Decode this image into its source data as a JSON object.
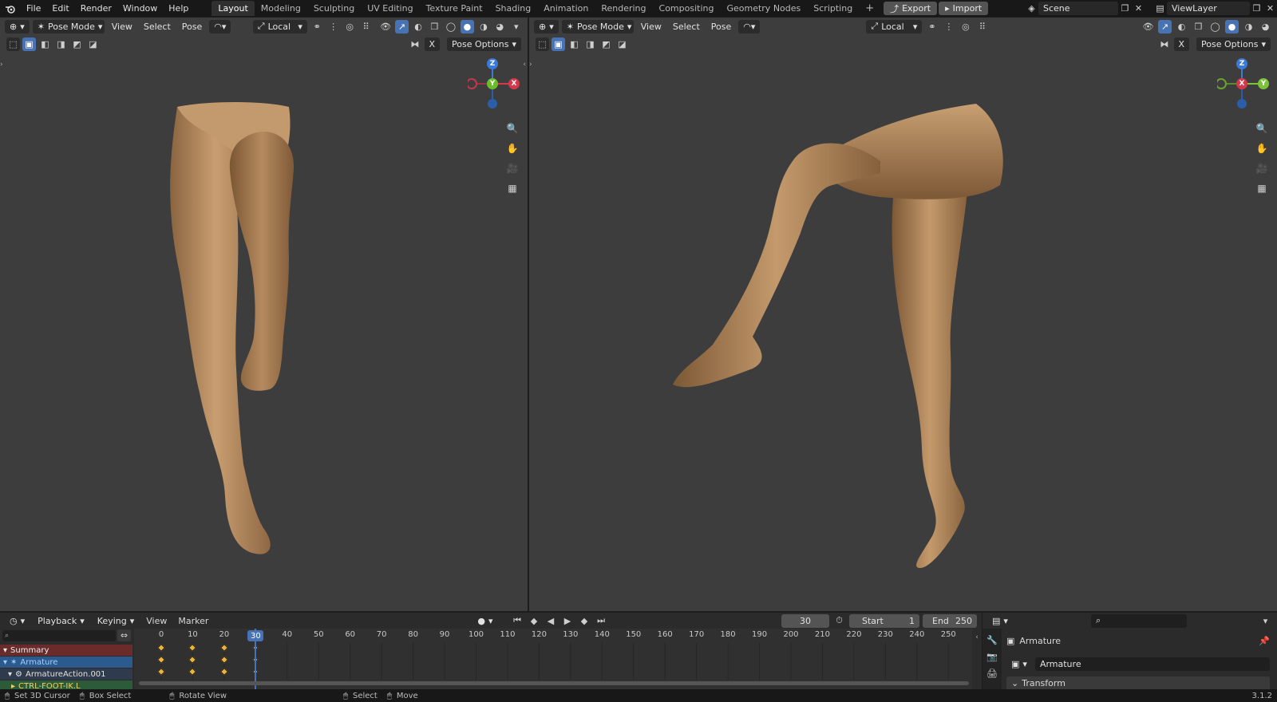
{
  "topbar": {
    "menus": [
      "File",
      "Edit",
      "Render",
      "Window",
      "Help"
    ],
    "workspaces": [
      "Layout",
      "Modeling",
      "Sculpting",
      "UV Editing",
      "Texture Paint",
      "Shading",
      "Animation",
      "Rendering",
      "Compositing",
      "Geometry Nodes",
      "Scripting"
    ],
    "active_workspace": "Layout",
    "add_tab": "+",
    "export_label": "Export",
    "import_label": "Import",
    "scene": "Scene",
    "view_layer": "ViewLayer"
  },
  "viewport_left": {
    "mode": "Pose Mode",
    "menus": [
      "View",
      "Select",
      "Pose"
    ],
    "orientation": "Local",
    "pose_options": "Pose Options",
    "x_label": "X",
    "gizmo": {
      "z": "Z",
      "y": "Y",
      "x": "X"
    }
  },
  "viewport_right": {
    "mode": "Pose Mode",
    "menus": [
      "View",
      "Select",
      "Pose"
    ],
    "orientation": "Local",
    "pose_options": "Pose Options",
    "x_label": "X",
    "gizmo": {
      "z": "Z",
      "y": "Y",
      "x": "X"
    }
  },
  "timeline": {
    "menus": [
      "Playback",
      "Keying",
      "View",
      "Marker"
    ],
    "current_frame": "30",
    "start_label": "Start",
    "start_value": "1",
    "end_label": "End",
    "end_value": "250",
    "ticks": [
      "0",
      "10",
      "20",
      "30",
      "40",
      "50",
      "60",
      "70",
      "80",
      "90",
      "100",
      "110",
      "120",
      "130",
      "140",
      "150",
      "160",
      "170",
      "180",
      "190",
      "200",
      "210",
      "220",
      "230",
      "240",
      "250"
    ],
    "channels": [
      "Summary",
      "Armature",
      "ArmatureAction.001",
      "CTRL-FOOT-IK.L"
    ],
    "keyframes": [
      0,
      10,
      20
    ]
  },
  "properties": {
    "object_name": "Armature",
    "data_name": "Armature",
    "section": "Transform"
  },
  "status": {
    "items": [
      "Set 3D Cursor",
      "Box Select",
      "Rotate View",
      "Select",
      "Move"
    ],
    "version": "3.1.2"
  },
  "colors": {
    "accent": "#4772b3",
    "keyframe": "#f0b43a",
    "skin": "#b88a5e",
    "summary": "#6b2b2b"
  }
}
